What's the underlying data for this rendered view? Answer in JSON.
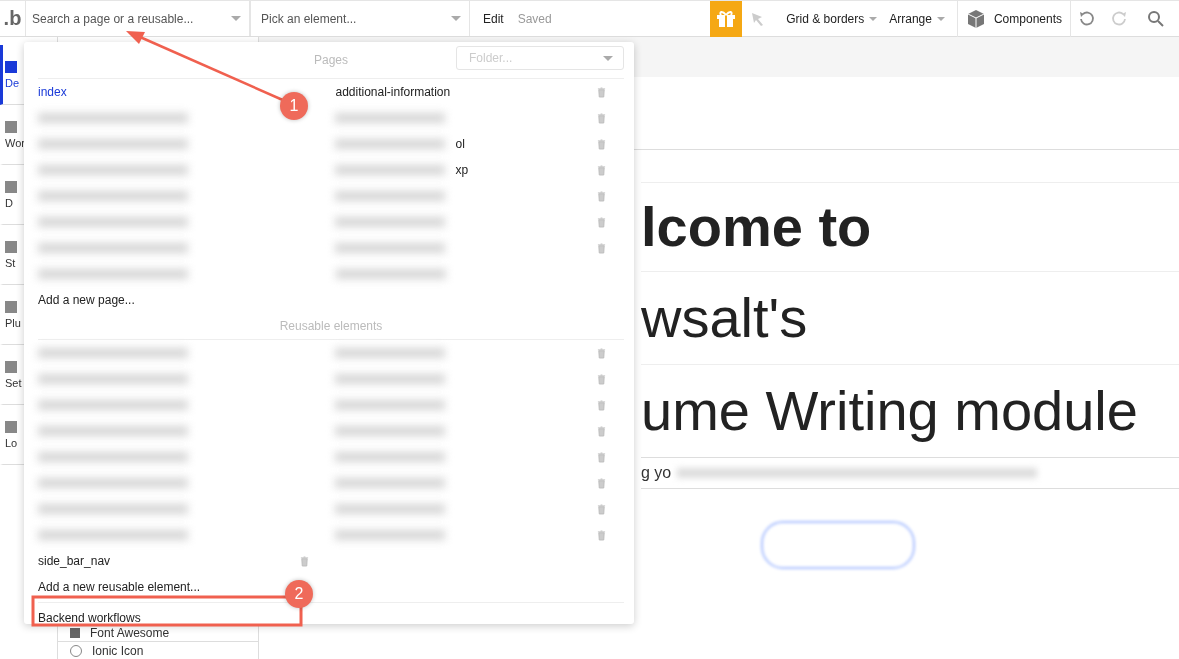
{
  "toolbar": {
    "logo": ".b",
    "page_search": {
      "placeholder": "Search a page or a reusable..."
    },
    "element_picker": {
      "placeholder": "Pick an element..."
    },
    "mode": "Edit",
    "save_status": "Saved",
    "menus": [
      "Grid & borders",
      "Arrange"
    ],
    "components": "Components"
  },
  "sidebar": {
    "items": [
      {
        "label": "De",
        "selected": true
      },
      {
        "label": "Wor",
        "selected": false
      },
      {
        "label": "D",
        "selected": false
      },
      {
        "label": "St",
        "selected": false
      },
      {
        "label": "Plu",
        "selected": false
      },
      {
        "label": "Set",
        "selected": false
      },
      {
        "label": "Lo",
        "selected": false
      }
    ]
  },
  "page_dropdown": {
    "pages_heading": "Pages",
    "folder": {
      "placeholder": "Folder..."
    },
    "pages": [
      {
        "kind": "named",
        "name": "index",
        "selected": true,
        "column_2": "additional-information",
        "deletable": true
      },
      {
        "kind": "redacted",
        "deletable": true
      },
      {
        "kind": "redacted",
        "tail": "ol",
        "deletable": true
      },
      {
        "kind": "redacted",
        "tail": "xp",
        "deletable": true
      },
      {
        "kind": "redacted",
        "deletable": true
      },
      {
        "kind": "redacted",
        "deletable": true
      },
      {
        "kind": "redacted",
        "deletable": true
      },
      {
        "kind": "redacted",
        "deletable": false
      }
    ],
    "add_page": "Add a new page...",
    "reusable_heading": "Reusable elements",
    "reusables": [
      {
        "kind": "redacted",
        "deletable": true
      },
      {
        "kind": "redacted",
        "deletable": true
      },
      {
        "kind": "redacted",
        "deletable": true
      },
      {
        "kind": "redacted",
        "deletable": true
      },
      {
        "kind": "redacted",
        "deletable": true
      },
      {
        "kind": "redacted",
        "deletable": true
      },
      {
        "kind": "redacted",
        "deletable": true
      },
      {
        "kind": "redacted",
        "deletable": true
      },
      {
        "kind": "named",
        "name": "side_bar_nav",
        "selected": false,
        "deletable": true
      }
    ],
    "add_reusable": "Add a new reusable element...",
    "backend": "Backend workflows"
  },
  "icon_panel": {
    "items": [
      {
        "label": "Font Awesome",
        "kind": "square"
      },
      {
        "label": "Ionic Icon",
        "kind": "circle"
      }
    ]
  },
  "canvas": {
    "headings": [
      "lcome to",
      "wsalt's",
      "ume Writing module"
    ],
    "subtitle": "g yo"
  },
  "annotations": [
    {
      "label": "1"
    },
    {
      "label": "2"
    }
  ]
}
